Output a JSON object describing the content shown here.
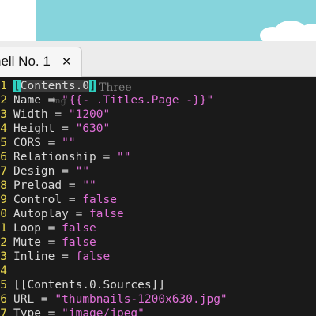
{
  "tab": {
    "title": "hell No. 1",
    "close_icon": "close-icon"
  },
  "overlay": {
    "ghost_text": "Three",
    "ghost_text2": "ing"
  },
  "lines": [
    {
      "num": "1",
      "key": "[Contents.0",
      "bracket": "]",
      "eq": "",
      "val": ""
    },
    {
      "num": "2",
      "key": "Name",
      "eq": " = ",
      "val": "\"{{- .Titles.Page -}}\""
    },
    {
      "num": "3",
      "key": "Width",
      "eq": " = ",
      "val": "\"1200\""
    },
    {
      "num": "4",
      "key": "Height",
      "eq": " = ",
      "val": "\"630\""
    },
    {
      "num": "5",
      "key": "CORS",
      "eq": " = ",
      "val": "\"\""
    },
    {
      "num": "6",
      "key": "Relationship",
      "eq": " = ",
      "val": "\"\""
    },
    {
      "num": "7",
      "key": "Design",
      "eq": " = ",
      "val": "\"\""
    },
    {
      "num": "8",
      "key": "Preload",
      "eq": " = ",
      "val": "\"\""
    },
    {
      "num": "9",
      "key": "Control",
      "eq": " = ",
      "val": "false"
    },
    {
      "num": "0",
      "key": "Autoplay",
      "eq": " = ",
      "val": "false"
    },
    {
      "num": "1",
      "key": "Loop",
      "eq": " = ",
      "val": "false"
    },
    {
      "num": "2",
      "key": "Mute",
      "eq": " = ",
      "val": "false"
    },
    {
      "num": "3",
      "key": "Inline",
      "eq": " = ",
      "val": "false"
    },
    {
      "num": "4",
      "key": "",
      "eq": "",
      "val": ""
    },
    {
      "num": "5",
      "key": "[[Contents.0.Sources]]",
      "eq": "",
      "val": ""
    },
    {
      "num": "6",
      "key": "URL",
      "eq": " = ",
      "val": "\"thumbnails-1200x630.jpg\""
    },
    {
      "num": "7",
      "key": "Type",
      "eq": " = ",
      "val": "\"image/jpeg\""
    }
  ],
  "colors": {
    "terminal_bg": "#1a1a1a",
    "line_number": "#e6d44e",
    "string_value": "#e070d8",
    "cursor": "#2fd0c0"
  }
}
